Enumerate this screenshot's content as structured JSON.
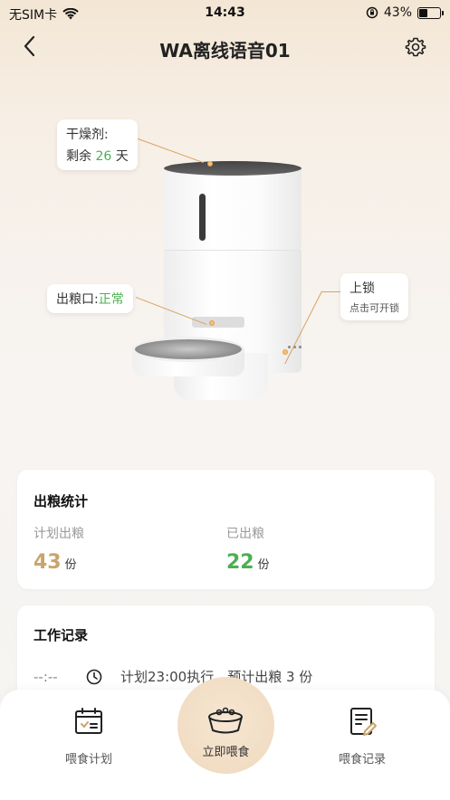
{
  "status_bar": {
    "carrier": "无SIM卡",
    "time": "14:43",
    "battery_percent": "43%",
    "battery_level": 0.43
  },
  "nav": {
    "title": "WA离线语音01"
  },
  "device": {
    "desiccant": {
      "title": "干燥剂:",
      "remain_prefix": "剩余",
      "remain_days": "26",
      "remain_unit": "天"
    },
    "outlet": {
      "label": "出粮口:",
      "status": "正常"
    },
    "lock": {
      "title": "上锁",
      "hint": "点击可开锁"
    }
  },
  "stats": {
    "title": "出粮统计",
    "planned_label": "计划出粮",
    "planned_value": "43",
    "planned_unit": "份",
    "done_label": "已出粮",
    "done_value": "22",
    "done_unit": "份"
  },
  "work_log": {
    "title": "工作记录",
    "time": "--:--",
    "text": "计划23:00执行，预计出粮 3 份"
  },
  "bottom_tabs": {
    "plan": "喂食计划",
    "feed_now": "立即喂食",
    "records": "喂食记录"
  },
  "colors": {
    "accent_gold": "#c9a46c",
    "green": "#4caf50"
  }
}
